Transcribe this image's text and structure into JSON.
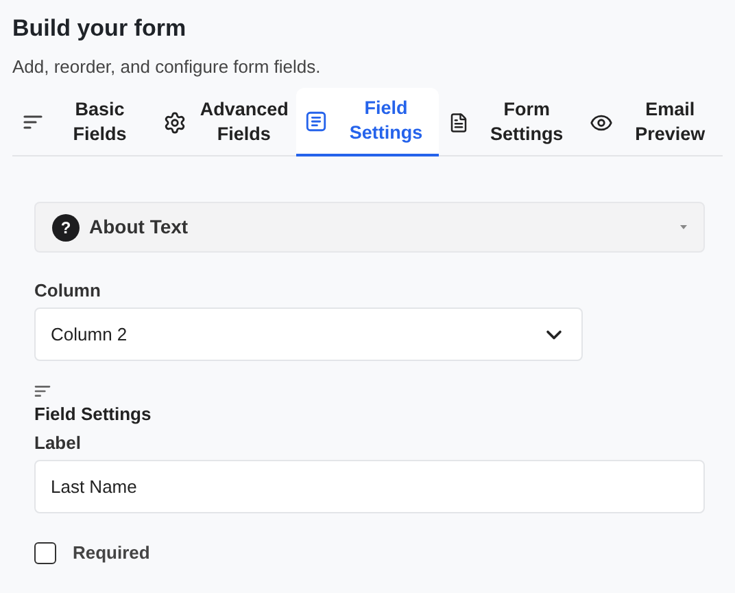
{
  "header": {
    "title": "Build your form",
    "subtitle": "Add, reorder, and configure form fields."
  },
  "tabs": [
    {
      "kind": "lines",
      "label": "Basic Fields",
      "selected": false
    },
    {
      "kind": "gear",
      "label": "Advanced Fields",
      "selected": false
    },
    {
      "kind": "note",
      "label": "Field Settings",
      "selected": true
    },
    {
      "kind": "file",
      "label": "Form Settings",
      "selected": false
    },
    {
      "kind": "eye",
      "label": "Email Preview",
      "selected": false
    }
  ],
  "accordion": {
    "icon": "?",
    "title": "About Text",
    "expanded": false
  },
  "column": {
    "label": "Column",
    "value": "Column 2"
  },
  "section": {
    "title": "Field Settings"
  },
  "label_field": {
    "label": "Label",
    "value": "Last Name"
  },
  "required": {
    "label": "Required",
    "checked": false
  }
}
